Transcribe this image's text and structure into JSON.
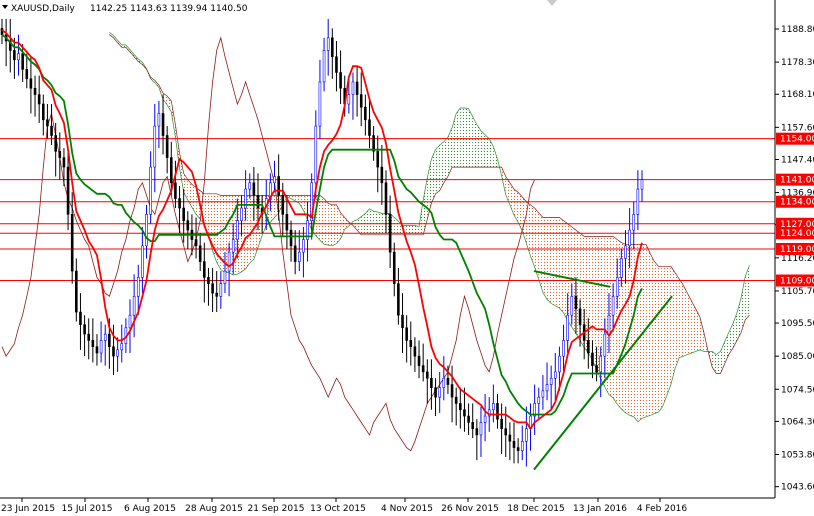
{
  "chart_data": {
    "type": "candlestick",
    "title": "XAUUSD,Daily",
    "ohlc_text": "1142.25 1143.63 1139.94 1140.50",
    "ylim": [
      1040,
      1198
    ],
    "x_ticks": [
      "23 Jun 2015",
      "15 Jul 2015",
      "6 Aug 2015",
      "28 Aug 2015",
      "21 Sep 2015",
      "13 Oct 2015",
      "4 Nov 2015",
      "26 Nov 2015",
      "18 Dec 2015",
      "13 Jan 2016",
      "4 Feb 2016"
    ],
    "y_ticks": [
      "1188.80",
      "1178.30",
      "1168.10",
      "1157.60",
      "1147.40",
      "1136.90",
      "1126.70",
      "1116.20",
      "1105.70",
      "1095.50",
      "1085.00",
      "1074.50",
      "1064.30",
      "1053.80",
      "1043.60"
    ],
    "levels": [
      {
        "label": "1154.00",
        "value": 1154.0
      },
      {
        "label": "1141.00",
        "value": 1141.0
      },
      {
        "label": "1134.00",
        "value": 1134.0
      },
      {
        "label": "1127.00",
        "value": 1127.0
      },
      {
        "label": "1124.00",
        "value": 1124.0
      },
      {
        "label": "1119.00",
        "value": 1119.0
      },
      {
        "label": "1109.00",
        "value": 1109.0
      }
    ],
    "closes": [
      1187,
      1185,
      1182,
      1179,
      1181,
      1176,
      1173,
      1170,
      1168,
      1165,
      1160,
      1158,
      1155,
      1150,
      1148,
      1145,
      1130,
      1112,
      1099,
      1095,
      1092,
      1090,
      1088,
      1086,
      1090,
      1092,
      1088,
      1085,
      1087,
      1089,
      1094,
      1098,
      1104,
      1110,
      1120,
      1130,
      1145,
      1158,
      1162,
      1155,
      1148,
      1140,
      1135,
      1132,
      1128,
      1125,
      1122,
      1120,
      1115,
      1110,
      1108,
      1105,
      1104,
      1108,
      1112,
      1118,
      1122,
      1128,
      1132,
      1138,
      1140,
      1136,
      1132,
      1130,
      1135,
      1140,
      1142,
      1136,
      1130,
      1125,
      1120,
      1115,
      1118,
      1122,
      1128,
      1140,
      1158,
      1172,
      1182,
      1186,
      1180,
      1175,
      1170,
      1165,
      1168,
      1172,
      1168,
      1164,
      1160,
      1155,
      1150,
      1145,
      1140,
      1130,
      1118,
      1108,
      1098,
      1094,
      1090,
      1088,
      1085,
      1082,
      1080,
      1078,
      1075,
      1072,
      1075,
      1078,
      1076,
      1072,
      1070,
      1068,
      1066,
      1064,
      1062,
      1060,
      1064,
      1066,
      1068,
      1070,
      1065,
      1062,
      1060,
      1058,
      1056,
      1055,
      1058,
      1062,
      1066,
      1070,
      1072,
      1074,
      1076,
      1078,
      1080,
      1085,
      1090,
      1098,
      1104,
      1100,
      1095,
      1090,
      1086,
      1082,
      1080,
      1085,
      1092,
      1098,
      1104,
      1110,
      1116,
      1120,
      1125,
      1130,
      1138,
      1141
    ],
    "ichimoku": {
      "tenkan_label": "Tenkan-sen",
      "kijun_label": "Kijun-sen",
      "tenkan_color": "#ff0000",
      "kijun_color": "#008000",
      "chikou_color": "#8b1a1a",
      "cloud_bull_color": "#2e8b2e",
      "cloud_bear_color": "#e8601c"
    },
    "trendlines": [
      {
        "from": [
          "18 Dec 2015",
          1049
        ],
        "to": [
          "4 Feb 2016",
          1104
        ],
        "color": "#008000"
      },
      {
        "from": [
          "18 Dec 2015",
          1112
        ],
        "to": [
          "13 Jan 2016",
          1107
        ],
        "color": "#008000"
      }
    ],
    "grid": false,
    "colors": {
      "candle_up": "#0000ff",
      "candle_down": "#000000",
      "level_line": "#ff0000",
      "level_label_bg": "#ff0000",
      "level_label_text": "#ffffff",
      "axis": "#000000"
    }
  },
  "ui": {
    "menu_arrow_icon": "triangle-down-icon"
  }
}
